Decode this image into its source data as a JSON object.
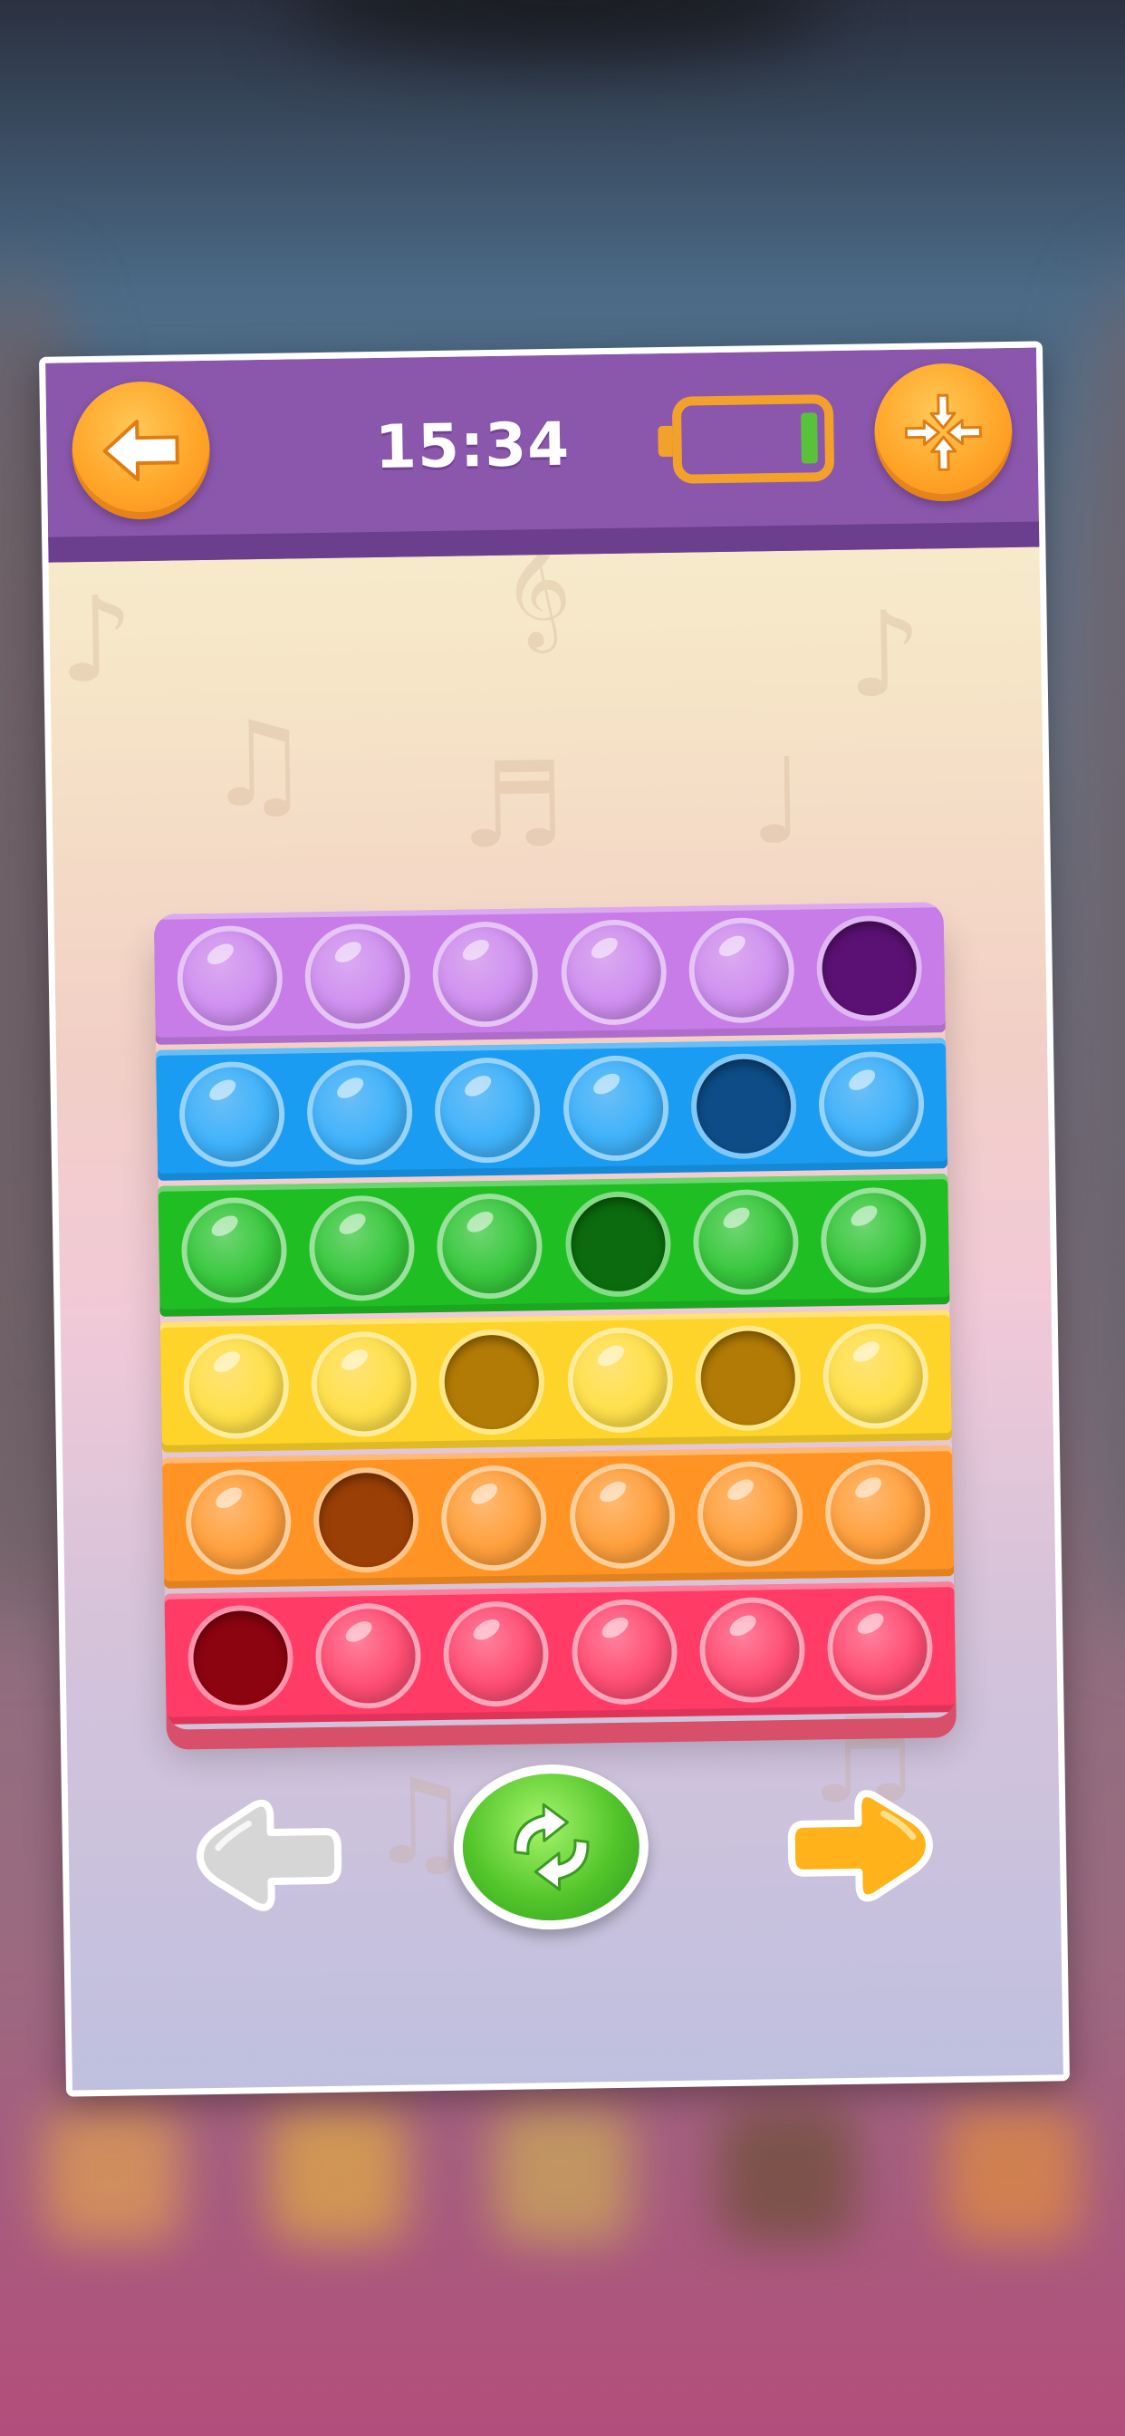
{
  "window": {
    "clock": "15:34",
    "battery_level_fraction": 0.15
  },
  "colors": {
    "topbar": "#8b57ad",
    "button_orange": "#ffa528",
    "refresh_green": "#53c52b"
  },
  "icons": {
    "back": "arrow-left-icon",
    "battery": "battery-low-icon",
    "expand": "collapse-arrows-icon",
    "prev": "arrow-left-icon",
    "refresh": "refresh-icon",
    "next": "arrow-right-icon"
  },
  "board": {
    "rows": [
      {
        "name": "purple",
        "color": "#c77ce8",
        "bubble": "#cf8ff0",
        "popped_color": "#5b1173",
        "popped": [
          5
        ]
      },
      {
        "name": "blue",
        "color": "#1a9cf2",
        "bubble": "#3fb2fb",
        "popped_color": "#0d4c86",
        "popped": [
          4
        ]
      },
      {
        "name": "green",
        "color": "#1fbf24",
        "bubble": "#37c73c",
        "popped_color": "#0b6b0e",
        "popped": [
          3
        ]
      },
      {
        "name": "yellow",
        "color": "#ffd42a",
        "bubble": "#ffe04a",
        "popped_color": "#b27b06",
        "popped": [
          2,
          4
        ]
      },
      {
        "name": "orange",
        "color": "#ff9425",
        "bubble": "#ff9f3c",
        "popped_color": "#9a3f06",
        "popped": [
          1
        ]
      },
      {
        "name": "red",
        "color": "#ff3b66",
        "bubble": "#ff4d73",
        "popped_color": "#8c0410",
        "popped": [
          0
        ]
      }
    ],
    "bubbles_per_row": 6
  }
}
